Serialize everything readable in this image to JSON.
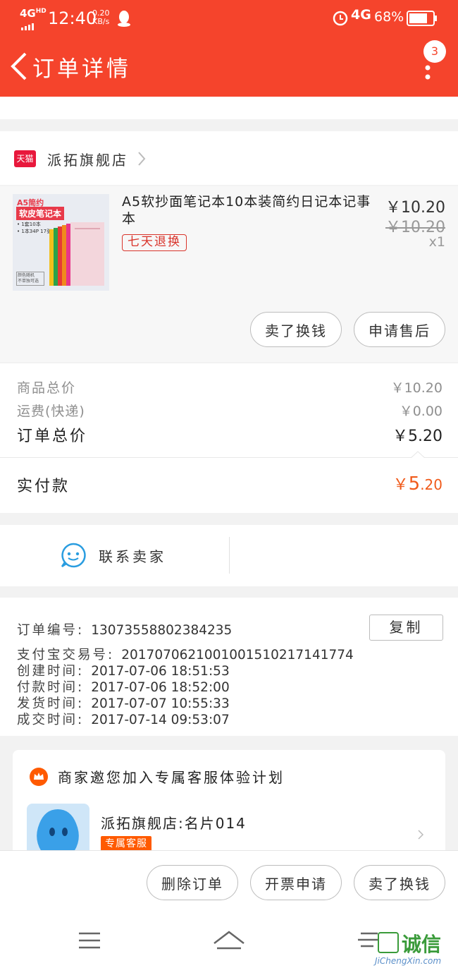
{
  "status_bar": {
    "network": "4G",
    "network_sup": "HD",
    "time": "12:40",
    "speed": "0.20",
    "speed_unit": "KB/s",
    "mobile_data": "4G",
    "battery": "68%"
  },
  "header": {
    "title": "订单详情",
    "notification_count": "3"
  },
  "shop": {
    "badge": "天猫",
    "name": "派拓旗舰店"
  },
  "product": {
    "image_title": "A5简约",
    "image_subtitle": "软皮笔记本",
    "image_line1": "• 1套10本",
    "image_line2": "• 1本34P 17张",
    "image_tag": "颜色随机\n不单独可选",
    "title": "A5软抄面笔记本10本装简约日记本记事本",
    "tag": "七天退换",
    "price": "￥10.20",
    "original_price": "￥10.20",
    "quantity": "x1",
    "btn_resell": "卖了换钱",
    "btn_after_sales": "申请售后"
  },
  "summary": {
    "goods_total_label": "商品总价",
    "goods_total_value": "￥10.20",
    "shipping_label": "运费(快递)",
    "shipping_value": "￥0.00",
    "order_total_label": "订单总价",
    "order_total_value": "￥5.20",
    "paid_label": "实付款",
    "paid_currency": "￥",
    "paid_int": "5",
    "paid_dec": ".20"
  },
  "contact": {
    "label": "联系卖家"
  },
  "order_info": {
    "copy_btn": "复制",
    "lines": [
      {
        "key": "订单编号:",
        "value": "13073558802384235"
      },
      {
        "key": "支付宝交易号:",
        "value": "2017070621001001510217141774"
      },
      {
        "key": "创建时间:",
        "value": "2017-07-06 18:51:53"
      },
      {
        "key": "付款时间:",
        "value": "2017-07-06 18:52:00"
      },
      {
        "key": "发货时间:",
        "value": "2017-07-07 10:55:33"
      },
      {
        "key": "成交时间:",
        "value": "2017-07-14 09:53:07"
      }
    ]
  },
  "service_plan": {
    "title": "商家邀您加入专属客服体验计划",
    "contact_name": "派拓旗舰店:名片014",
    "contact_tag": "专属客服"
  },
  "bottom_actions": {
    "delete": "删除订单",
    "invoice": "开票申请",
    "resell": "卖了换钱"
  },
  "watermark": {
    "brand": "诚信",
    "url": "JiChengXin.com"
  },
  "colors": {
    "brand_red": "#f5442c",
    "tag_red": "#d9342b",
    "paid_orange": "#f05a1a",
    "service_orange": "#ff5a00"
  }
}
